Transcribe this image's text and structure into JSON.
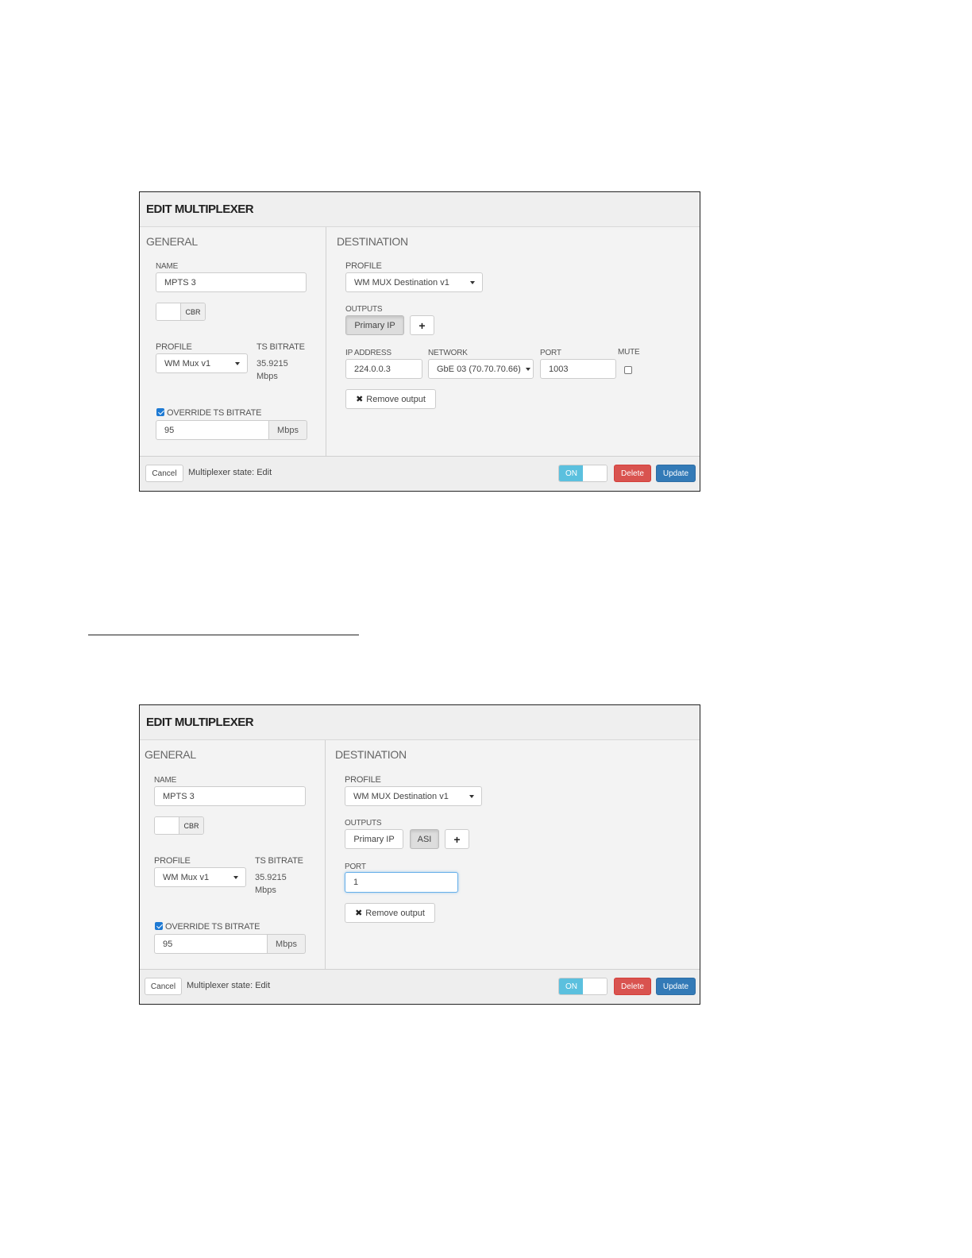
{
  "modal1": {
    "title": "EDIT MULTIPLEXER",
    "general": {
      "title": "GENERAL",
      "name_label": "NAME",
      "name_value": "MPTS 3",
      "cbr_label": "CBR",
      "profile_label": "PROFILE",
      "profile_value": "WM Mux v1",
      "ts_bitrate_label": "TS BITRATE",
      "ts_bitrate_value": "35.9215",
      "ts_bitrate_unit": "Mbps",
      "override_label": "OVERRIDE TS BITRATE",
      "override_checked": true,
      "override_value": "95",
      "override_unit": "Mbps"
    },
    "destination": {
      "title": "DESTINATION",
      "profile_label": "PROFILE",
      "profile_value": "WM MUX Destination v1",
      "outputs_label": "OUTPUTS",
      "outputs": [
        "Primary IP"
      ],
      "add_label": "+",
      "ip_address_label": "IP ADDRESS",
      "ip_address_value": "224.0.0.3",
      "network_label": "NETWORK",
      "network_value": "GbE 03 (70.70.70.66)",
      "port_label": "PORT",
      "port_value": "1003",
      "mute_label": "MUTE",
      "remove_label": "Remove output"
    },
    "footer": {
      "cancel_label": "Cancel",
      "state_text": "Multiplexer state: Edit",
      "on_label": "ON",
      "delete_label": "Delete",
      "update_label": "Update"
    }
  },
  "modal2": {
    "title": "EDIT MULTIPLEXER",
    "general": {
      "title": "GENERAL",
      "name_label": "NAME",
      "name_value": "MPTS 3",
      "cbr_label": "CBR",
      "profile_label": "PROFILE",
      "profile_value": "WM Mux v1",
      "ts_bitrate_label": "TS BITRATE",
      "ts_bitrate_value": "35.9215",
      "ts_bitrate_unit": "Mbps",
      "override_label": "OVERRIDE TS BITRATE",
      "override_checked": true,
      "override_value": "95",
      "override_unit": "Mbps"
    },
    "destination": {
      "title": "DESTINATION",
      "profile_label": "PROFILE",
      "profile_value": "WM MUX Destination v1",
      "outputs_label": "OUTPUTS",
      "outputs": [
        "Primary IP",
        "ASI"
      ],
      "add_label": "+",
      "port_label": "PORT",
      "port_value": "1",
      "remove_label": "Remove output"
    },
    "footer": {
      "cancel_label": "Cancel",
      "state_text": "Multiplexer state: Edit",
      "on_label": "ON",
      "delete_label": "Delete",
      "update_label": "Update"
    }
  }
}
